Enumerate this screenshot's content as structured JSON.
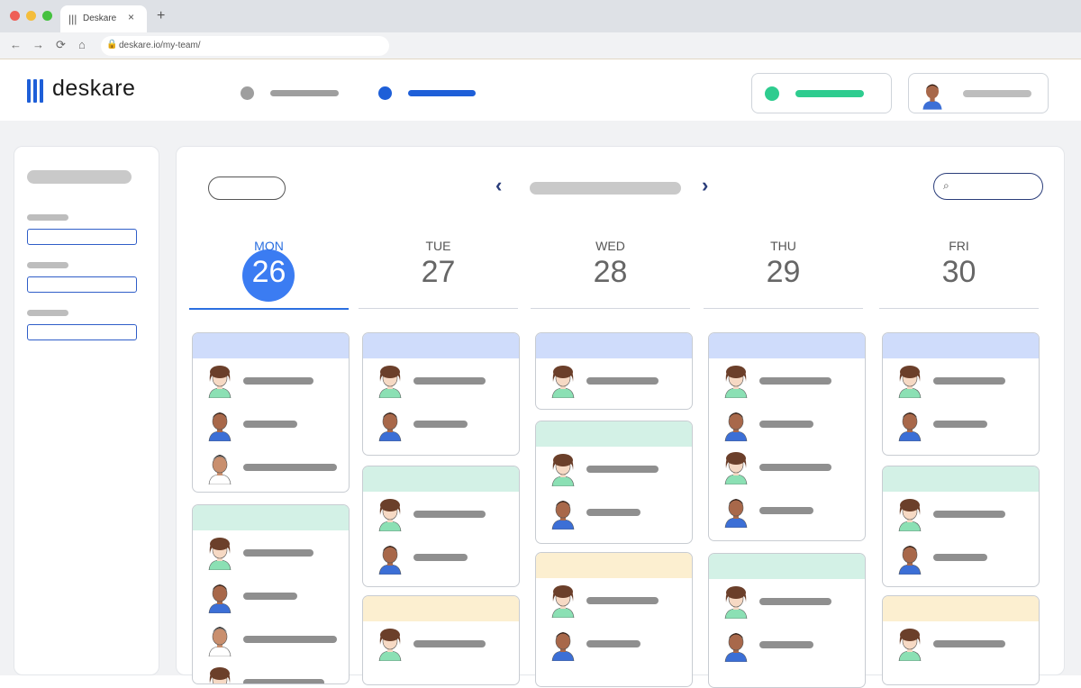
{
  "browser": {
    "tab_title": "Deskare",
    "tab_icon": "|||",
    "tab_close": "×",
    "new_tab": "+",
    "url": "deskare.io/my-team/",
    "nav_back": "←",
    "nav_forward": "→",
    "nav_reload": "⟳",
    "nav_home": "⌂",
    "lock_icon": "🔒"
  },
  "app": {
    "logo_text": "deskare"
  },
  "calendar": {
    "prev": "‹",
    "next": "›",
    "search_icon": "⌕",
    "days": [
      {
        "name": "MON",
        "num": "26",
        "active": true
      },
      {
        "name": "TUE",
        "num": "27",
        "active": false
      },
      {
        "name": "WED",
        "num": "28",
        "active": false
      },
      {
        "name": "THU",
        "num": "29",
        "active": false
      },
      {
        "name": "FRI",
        "num": "30",
        "active": false
      }
    ]
  },
  "colors": {
    "accent": "#3b7cf2",
    "header_green": "#2ecc8f",
    "header_blue": "#1e5fd8",
    "card_blue": "#cfdcfb",
    "card_green": "#d3f1e6",
    "card_yellow": "#fcefd0"
  }
}
